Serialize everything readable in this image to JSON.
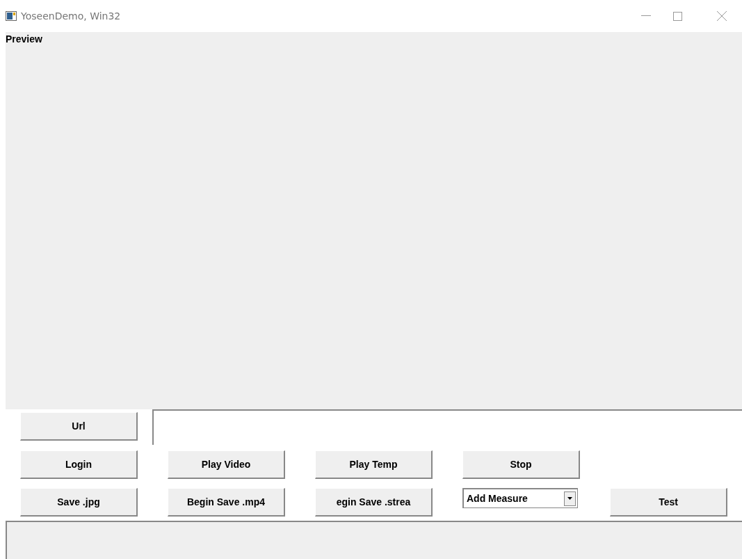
{
  "window": {
    "title": "YoseenDemo, Win32"
  },
  "preview": {
    "label": "Preview"
  },
  "url_row": {
    "button": "Url"
  },
  "rows": [
    [
      {
        "kind": "button",
        "label": "Login"
      },
      {
        "kind": "button",
        "label": "Play Video"
      },
      {
        "kind": "button",
        "label": "Play Temp"
      },
      {
        "kind": "button",
        "label": "Stop"
      }
    ],
    [
      {
        "kind": "button",
        "label": "Save .jpg"
      },
      {
        "kind": "button",
        "label": "Begin Save .mp4"
      },
      {
        "kind": "clipped",
        "label": "egin Save .strea"
      },
      {
        "kind": "combo",
        "label": "Add Measure"
      },
      {
        "kind": "button",
        "label": "Test"
      }
    ]
  ]
}
